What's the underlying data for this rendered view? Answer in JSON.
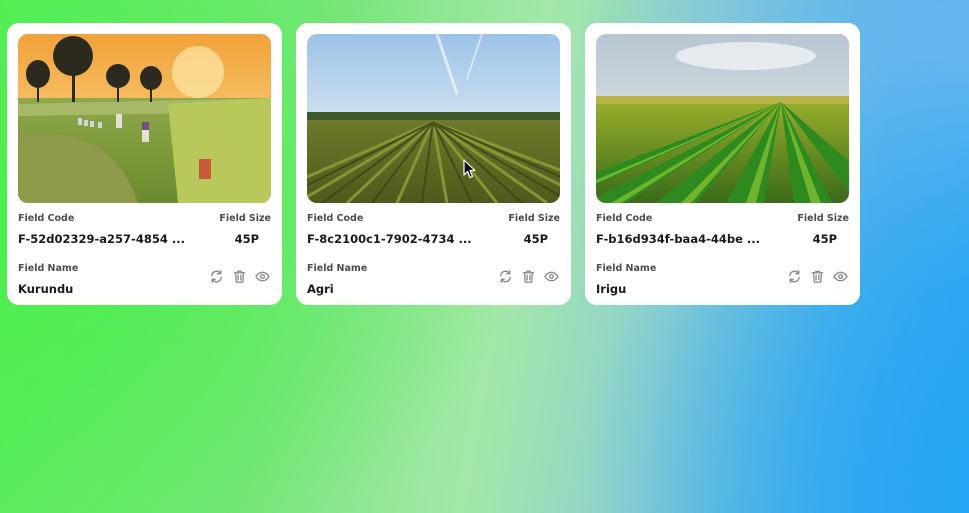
{
  "cards": [
    {
      "image": "rice-field-harvest-sunset",
      "field_code_label": "Field Code",
      "field_code": "F-52d02329-a257-4854 ...",
      "field_size_label": "Field Size",
      "field_size": "45P",
      "field_name_label": "Field Name",
      "field_name": "Kurundu",
      "icons": [
        "refresh-icon",
        "trash-icon",
        "eye-icon"
      ]
    },
    {
      "image": "crop-rows-blue-sky",
      "field_code_label": "Field Code",
      "field_code": "F-8c2100c1-7902-4734 ...",
      "field_size_label": "Field Size",
      "field_size": "45P",
      "field_name_label": "Field Name",
      "field_name": "Agri",
      "icons": [
        "refresh-icon",
        "trash-icon",
        "eye-icon"
      ]
    },
    {
      "image": "green-crop-rows-sunlight",
      "field_code_label": "Field Code",
      "field_code": "F-b16d934f-baa4-44be ...",
      "field_size_label": "Field Size",
      "field_size": "45P",
      "field_name_label": "Field Name",
      "field_name": "Irigu",
      "icons": [
        "refresh-icon",
        "trash-icon",
        "eye-icon"
      ]
    }
  ],
  "colors": {
    "background_left": "#4cef4f",
    "background_right": "#26a6f4",
    "card": "#ffffff",
    "icon": "#8a8a8a"
  }
}
